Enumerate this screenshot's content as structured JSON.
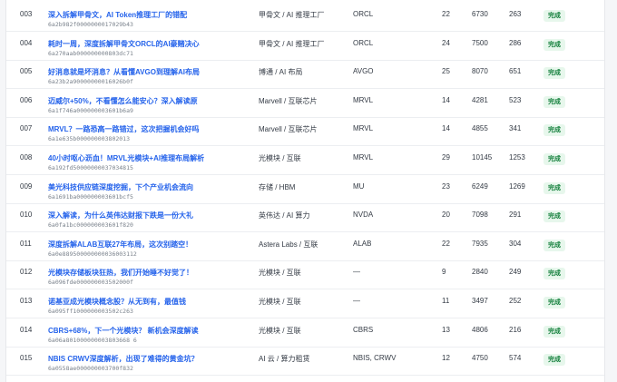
{
  "rows": [
    {
      "id": "003",
      "title": "深入拆解甲骨文，AI Token推理工厂的错配",
      "hash": "6a2b982f0000000017029b43",
      "category": "甲骨文 / AI 推理工厂",
      "ticker": "ORCL",
      "a": "22",
      "b": "6730",
      "c": "263",
      "status": "完成"
    },
    {
      "id": "004",
      "title": "耗时一周，深度拆解甲骨文ORCL的AI豪赌决心",
      "hash": "6a270aab000000000803dc71",
      "category": "甲骨文 / AI 推理工厂",
      "ticker": "ORCL",
      "a": "24",
      "b": "7500",
      "c": "286",
      "status": "完成"
    },
    {
      "id": "005",
      "title": "好消息就是坏消息？从看懂AVGO到理解AI布局",
      "hash": "6a23b2a90000000016026b0f",
      "category": "博通 / AI 布局",
      "ticker": "AVGO",
      "a": "25",
      "b": "8070",
      "c": "651",
      "status": "完成"
    },
    {
      "id": "006",
      "title": "迈威尔+50%，不看懂怎么能安心？深入解读原",
      "hash": "6a1f746a000000003601b6a9",
      "category": "Marvell / 互联芯片",
      "ticker": "MRVL",
      "a": "14",
      "b": "4281",
      "c": "523",
      "status": "完成"
    },
    {
      "id": "007",
      "title": "MRVL？一路恐高一路错过，这次把握机会好吗",
      "hash": "6a1e635b000000003802013",
      "category": "Marvell / 互联芯片",
      "ticker": "MRVL",
      "a": "14",
      "b": "4855",
      "c": "341",
      "status": "完成"
    },
    {
      "id": "008",
      "title": "40小时呕心沥血！MRVL光模块+AI推理布局解析",
      "hash": "6a192fd50000000037034815",
      "category": "光模块 / 互联",
      "ticker": "MRVL",
      "a": "29",
      "b": "10145",
      "c": "1253",
      "status": "完成"
    },
    {
      "id": "009",
      "title": "美光科技供应链深度挖掘，下个产业机会流向",
      "hash": "6a1691ba000000003601bcf5",
      "category": "存储 / HBM",
      "ticker": "MU",
      "a": "23",
      "b": "6249",
      "c": "1269",
      "status": "完成"
    },
    {
      "id": "010",
      "title": "深入解读，为什么英伟达财报下跌是一份大礼",
      "hash": "6a0fa1bc000000003601f820",
      "category": "英伟达 / AI 算力",
      "ticker": "NVDA",
      "a": "20",
      "b": "7098",
      "c": "291",
      "status": "完成"
    },
    {
      "id": "011",
      "title": "深度拆解ALAB互联27年布局，这次别踏空！",
      "hash": "6a0e889500000000036003112",
      "category": "Astera Labs / 互联",
      "ticker": "ALAB",
      "a": "22",
      "b": "7935",
      "c": "304",
      "status": "完成"
    },
    {
      "id": "012",
      "title": "光模块存储板块狂热，我们开始睡不好觉了！",
      "hash": "6a096fde000000003502000f",
      "category": "光模块 / 互联",
      "ticker": "—",
      "a": "9",
      "b": "2840",
      "c": "249",
      "status": "完成"
    },
    {
      "id": "013",
      "title": "诺基亚成光模块概念股？从无到有，最值钱",
      "hash": "6a095ff1000000003502c263",
      "category": "光模块 / 互联",
      "ticker": "—",
      "a": "11",
      "b": "3497",
      "c": "252",
      "status": "完成"
    },
    {
      "id": "014",
      "title": "CBRS+68%，下一个光模块？ 新机会深度解读",
      "hash": "6a06a801000000003803668 6",
      "category": "光模块 / 互联",
      "ticker": "CBRS",
      "a": "13",
      "b": "4806",
      "c": "216",
      "status": "完成"
    },
    {
      "id": "015",
      "title": "NBIS CRWV深度解析，出现了难得的黄金坑？",
      "hash": "6a0558ae000000003700f832",
      "category": "AI 云 / 算力租赁",
      "ticker": "NBIS, CRWV",
      "a": "12",
      "b": "4750",
      "c": "574",
      "status": "完成"
    }
  ]
}
